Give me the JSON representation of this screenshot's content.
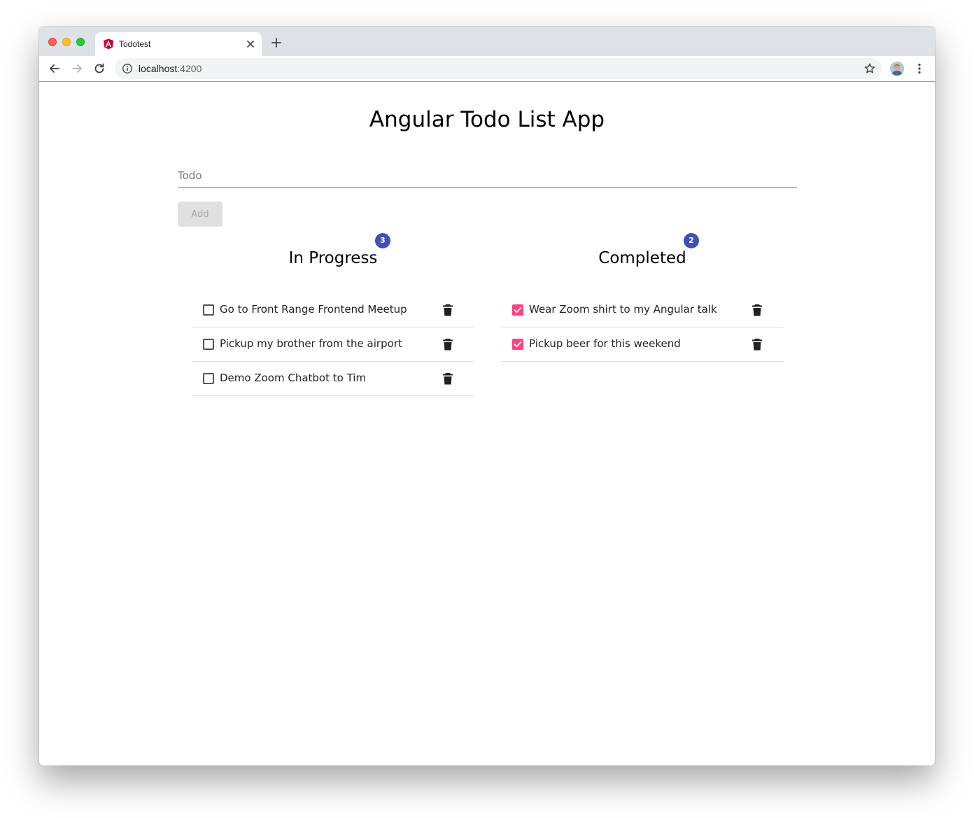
{
  "browser": {
    "tab_title": "Todotest",
    "url_host": "localhost",
    "url_port": ":4200"
  },
  "app": {
    "title": "Angular Todo List App",
    "input_placeholder": "Todo",
    "add_label": "Add"
  },
  "in_progress": {
    "heading": "In Progress",
    "count": "3",
    "items": [
      {
        "label": "Go to Front Range Frontend Meetup",
        "checked": false
      },
      {
        "label": "Pickup my brother from the airport",
        "checked": false
      },
      {
        "label": "Demo Zoom Chatbot to Tim",
        "checked": false
      }
    ]
  },
  "completed": {
    "heading": "Completed",
    "count": "2",
    "items": [
      {
        "label": "Wear Zoom shirt to my Angular talk",
        "checked": true
      },
      {
        "label": "Pickup beer for this weekend",
        "checked": true
      }
    ]
  },
  "colors": {
    "badge": "#3f51b5",
    "checkbox_checked": "#ff4081"
  }
}
